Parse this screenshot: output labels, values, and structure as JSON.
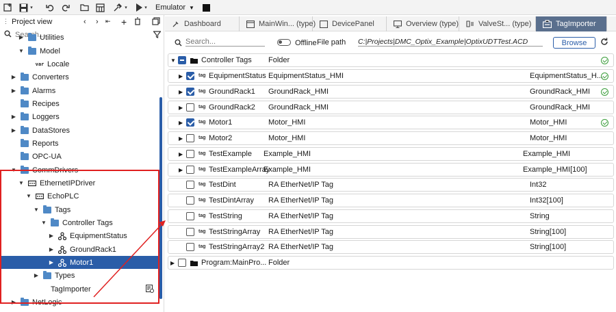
{
  "toolbar": {
    "emulator_label": "Emulator"
  },
  "left_panel": {
    "title": "Project view",
    "search_placeholder": "Search...",
    "tree": [
      {
        "label": "Utilities",
        "icon": "folder-icon",
        "expander": "right"
      },
      {
        "label": "Model",
        "icon": "folder-icon",
        "expander": "down"
      },
      {
        "label": "Locale",
        "icon": "var-icon",
        "expander": "",
        "prefix": "var"
      },
      {
        "label": "Converters",
        "icon": "folder-icon",
        "expander": "right"
      },
      {
        "label": "Alarms",
        "icon": "folder-icon",
        "expander": "right"
      },
      {
        "label": "Recipes",
        "icon": "folder-icon",
        "expander": ""
      },
      {
        "label": "Loggers",
        "icon": "folder-icon",
        "expander": "right"
      },
      {
        "label": "DataStores",
        "icon": "folder-icon",
        "expander": "right"
      },
      {
        "label": "Reports",
        "icon": "folder-icon",
        "expander": ""
      },
      {
        "label": "OPC-UA",
        "icon": "folder-icon",
        "expander": ""
      },
      {
        "label": "CommDrivers",
        "icon": "folder-icon",
        "expander": "down"
      },
      {
        "label": "EthernetIPDriver",
        "icon": "driver-icon",
        "expander": "down"
      },
      {
        "label": "EchoPLC",
        "icon": "plc-icon",
        "expander": "down"
      },
      {
        "label": "Tags",
        "icon": "folder-icon",
        "expander": "down"
      },
      {
        "label": "Controller Tags",
        "icon": "folder-icon",
        "expander": "down"
      },
      {
        "label": "EquipmentStatus",
        "icon": "struct-icon",
        "expander": "right"
      },
      {
        "label": "GroundRack1",
        "icon": "struct-icon",
        "expander": "right"
      },
      {
        "label": "Motor1",
        "icon": "struct-icon",
        "expander": "right",
        "selected": true
      },
      {
        "label": "Types",
        "icon": "folder-icon",
        "expander": "right"
      },
      {
        "label": "TagImporter",
        "icon": "",
        "expander": ""
      },
      {
        "label": "NetLogic",
        "icon": "folder-icon",
        "expander": "right"
      }
    ]
  },
  "tabs": [
    {
      "label": "Dashboard",
      "icon": "dashboard-icon"
    },
    {
      "label": "MainWin... (type)",
      "icon": "window-icon"
    },
    {
      "label": "DevicePanel",
      "icon": "panel-icon"
    },
    {
      "label": "Overview (type)",
      "icon": "monitor-icon"
    },
    {
      "label": "ValveSt... (type)",
      "icon": "valve-icon"
    },
    {
      "label": "TagImporter",
      "icon": "importer-icon",
      "active": true
    }
  ],
  "importer": {
    "search_placeholder": "Search...",
    "offline_label": "Offline",
    "filepath_label": "File path",
    "filepath_value": "C:|Projects|DMC_Optix_Example|OptixUDTTest.ACD",
    "browse_label": "Browse",
    "rows": [
      {
        "name": "Controller Tags",
        "type": "Folder",
        "target": "",
        "check": "partial",
        "expander": "down",
        "icon": "folder",
        "status": true
      },
      {
        "name": "EquipmentStatus",
        "type": "EquipmentStatus_HMI",
        "target": "EquipmentStatus_H...",
        "check": "on",
        "expander": "right",
        "icon": "tag",
        "status": true
      },
      {
        "name": "GroundRack1",
        "type": "GroundRack_HMI",
        "target": "GroundRack_HMI",
        "check": "on",
        "expander": "right",
        "icon": "tag",
        "status": true
      },
      {
        "name": "GroundRack2",
        "type": "GroundRack_HMI",
        "target": "GroundRack_HMI",
        "check": "off",
        "expander": "right",
        "icon": "tag",
        "status": false
      },
      {
        "name": "Motor1",
        "type": "Motor_HMI",
        "target": "Motor_HMI",
        "check": "on",
        "expander": "right",
        "icon": "tag",
        "status": true
      },
      {
        "name": "Motor2",
        "type": "Motor_HMI",
        "target": "Motor_HMI",
        "check": "off",
        "expander": "right",
        "icon": "tag",
        "status": false
      },
      {
        "name": "TestExample",
        "type": "Example_HMI",
        "target": "Example_HMI",
        "check": "off",
        "expander": "right",
        "icon": "tag",
        "status": false
      },
      {
        "name": "TestExampleArray",
        "type": "Example_HMI",
        "target": "Example_HMI[100]",
        "check": "off",
        "expander": "right",
        "icon": "tag",
        "status": false
      },
      {
        "name": "TestDint",
        "type": "RA EtherNet/IP Tag",
        "target": "Int32",
        "check": "off",
        "expander": "",
        "icon": "tag",
        "status": false
      },
      {
        "name": "TestDintArray",
        "type": "RA EtherNet/IP Tag",
        "target": "Int32[100]",
        "check": "off",
        "expander": "",
        "icon": "tag",
        "status": false
      },
      {
        "name": "TestString",
        "type": "RA EtherNet/IP Tag",
        "target": "String",
        "check": "off",
        "expander": "",
        "icon": "tag",
        "status": false
      },
      {
        "name": "TestStringArray",
        "type": "RA EtherNet/IP Tag",
        "target": "String[100]",
        "check": "off",
        "expander": "",
        "icon": "tag",
        "status": false
      },
      {
        "name": "TestStringArray2",
        "type": "RA EtherNet/IP Tag",
        "target": "String[100]",
        "check": "off",
        "expander": "",
        "icon": "tag",
        "status": false
      },
      {
        "name": "Program:MainPro...",
        "type": "Folder",
        "target": "",
        "check": "off",
        "expander": "right",
        "icon": "folder",
        "status": false
      }
    ]
  },
  "colors": {
    "accent": "#2a5da8",
    "annotation": "#e02020",
    "status_ok": "#3a9d3a",
    "active_tab": "#5a6f8d"
  },
  "tag_word": "tag"
}
